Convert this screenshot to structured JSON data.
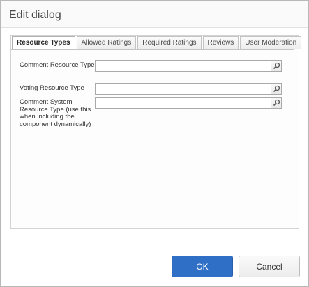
{
  "dialog": {
    "title": "Edit dialog"
  },
  "tabs": [
    {
      "label": "Resource Types",
      "active": true
    },
    {
      "label": "Allowed Ratings",
      "active": false
    },
    {
      "label": "Required Ratings",
      "active": false
    },
    {
      "label": "Reviews",
      "active": false
    },
    {
      "label": "User Moderation",
      "active": false
    }
  ],
  "fields": [
    {
      "label": "Comment Resource Type",
      "value": "",
      "button_icon": "search-icon"
    },
    {
      "label": "Voting Resource Type",
      "value": "",
      "button_icon": "search-icon"
    },
    {
      "label": "Comment System Resource Type (use this when including the component dynamically)",
      "value": "",
      "button_icon": "search-icon"
    }
  ],
  "footer": {
    "ok_label": "OK",
    "cancel_label": "Cancel"
  },
  "colors": {
    "primary_button": "#2f6fc6",
    "border": "#d3d3d3"
  }
}
